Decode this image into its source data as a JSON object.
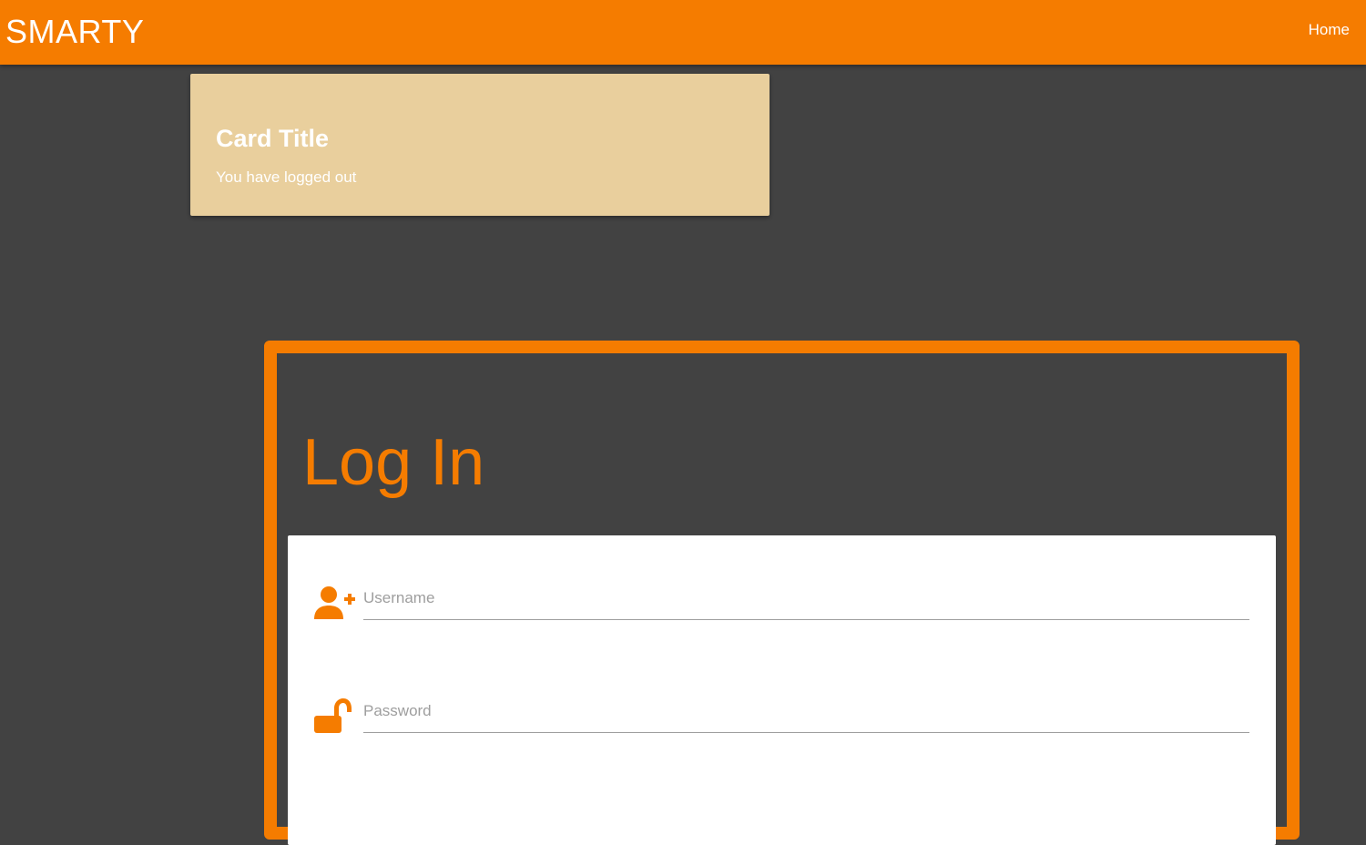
{
  "navbar": {
    "brand": "SMARTY",
    "links": [
      {
        "label": "Home"
      }
    ]
  },
  "card": {
    "title": "Card Title",
    "text": "You have logged out"
  },
  "login": {
    "title": "Log In",
    "fields": {
      "username": {
        "placeholder": "Username",
        "value": "",
        "icon": "person-add-icon"
      },
      "password": {
        "placeholder": "Password",
        "value": "",
        "icon": "lock-open-icon"
      }
    }
  },
  "colors": {
    "accent": "#f57c00",
    "background": "#424242",
    "card": "#e9cf9d",
    "panel": "#ffffff"
  }
}
